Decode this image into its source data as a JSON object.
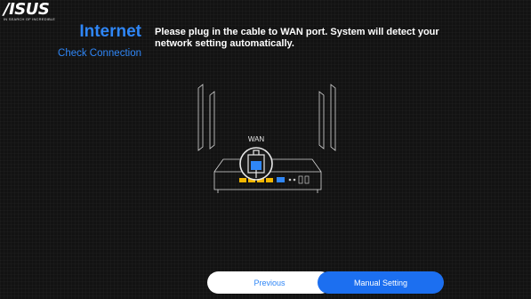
{
  "brand": {
    "logo_text": "/ISUS",
    "tagline": "IN SEARCH OF INCREDIBLE"
  },
  "header": {
    "title": "Internet",
    "subtitle": "Check Connection"
  },
  "message": "Please plug in the cable to WAN port. System will detect your network setting automatically.",
  "illustration": {
    "port_label": "WAN"
  },
  "buttons": {
    "previous": "Previous",
    "next": "Manual Setting"
  },
  "colors": {
    "accent": "#2f86f6",
    "button_primary": "#1c6ff0",
    "background": "#121212"
  }
}
